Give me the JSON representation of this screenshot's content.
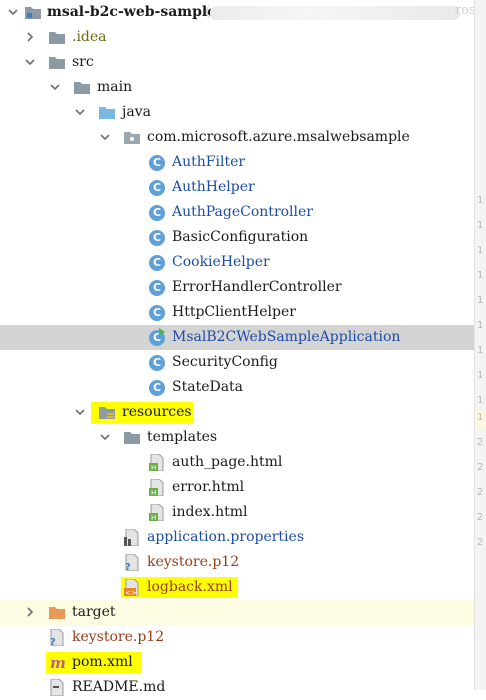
{
  "tree": {
    "rows": [
      {
        "label": "msal-b2c-web-sample",
        "suffix": "(",
        "tail": "ros"
      },
      {
        "label": ".idea"
      },
      {
        "label": "src"
      },
      {
        "label": "main"
      },
      {
        "label": "java"
      },
      {
        "label": "com.microsoft.azure.msalwebsample"
      },
      {
        "label": "AuthFilter"
      },
      {
        "label": "AuthHelper"
      },
      {
        "label": "AuthPageController"
      },
      {
        "label": "BasicConfiguration"
      },
      {
        "label": "CookieHelper"
      },
      {
        "label": "ErrorHandlerController"
      },
      {
        "label": "HttpClientHelper"
      },
      {
        "label": "MsalB2CWebSampleApplication"
      },
      {
        "label": "SecurityConfig"
      },
      {
        "label": "StateData"
      },
      {
        "label": "resources"
      },
      {
        "label": "templates"
      },
      {
        "label": "auth_page.html"
      },
      {
        "label": "error.html"
      },
      {
        "label": "index.html"
      },
      {
        "label": "application.properties"
      },
      {
        "label": "keystore.p12"
      },
      {
        "label": "logback.xml"
      },
      {
        "label": "target"
      },
      {
        "label": "keystore.p12"
      },
      {
        "label": "pom.xml"
      },
      {
        "label": "README.md"
      }
    ]
  },
  "colors": {
    "selected_row": "#d4d4d4",
    "highlight": "#ffff00",
    "class_icon": "#5fa0d8",
    "modified_blue": "#1b4da8",
    "untracked_brown": "#9a3d14",
    "ignored_olive": "#6d6d12"
  },
  "icons": {
    "folder": "folder-icon",
    "class": "class-icon",
    "html": "html-file-icon",
    "properties": "properties-file-icon",
    "xml": "xml-file-icon",
    "maven": "maven-icon"
  },
  "gutter": [
    "1",
    "1",
    "1",
    "1",
    "1",
    "1",
    "1",
    "1",
    "1",
    "1",
    "2",
    "2",
    "2",
    "2",
    "2"
  ]
}
